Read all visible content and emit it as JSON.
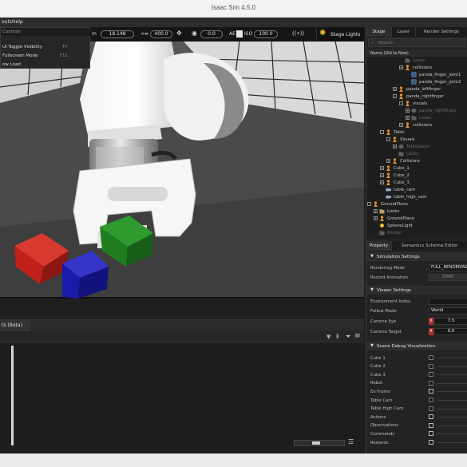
{
  "window": {
    "title": "Isaac Sim 4.5.0"
  },
  "menubar": {
    "items": [
      "outs",
      "Help"
    ]
  },
  "dropdown": {
    "header": "Controls",
    "items": [
      {
        "label": "UI Toggle Visibility",
        "shortcut": "F7"
      },
      {
        "label": "Fullscreen Mode",
        "shortcut": "F11"
      },
      {
        "label": "ow Load",
        "shortcut": ""
      }
    ]
  },
  "viewport_toolbar": {
    "prefix": "m",
    "focal_value": "18.148",
    "near_value": "400.0",
    "exposure_value": "0.0",
    "ae_label": "AE",
    "iso_label": "ISO",
    "iso_value": "100.0",
    "stage_lights_label": "Stage Lights",
    "overlay_tag": "RTX"
  },
  "console": {
    "tab_label": "ts (Beta)"
  },
  "stage": {
    "tabs": [
      "Stage",
      "Layer",
      "Render Settings"
    ],
    "search_placeholder": "Search",
    "column_header": "Name (Old to New)",
    "tree": [
      {
        "label": "Looks",
        "depth": 5,
        "icon": "folder",
        "dim": true,
        "expander": ""
      },
      {
        "label": "collisions",
        "depth": 5,
        "icon": "xform",
        "dim": false,
        "expander": "+"
      },
      {
        "label": "panda_finger_joint1",
        "depth": 6,
        "icon": "joint",
        "dim": false,
        "expander": ""
      },
      {
        "label": "panda_finger_joint2",
        "depth": 6,
        "icon": "joint",
        "dim": false,
        "expander": ""
      },
      {
        "label": "panda_leftfinger",
        "depth": 4,
        "icon": "xform",
        "dim": false,
        "expander": "+"
      },
      {
        "label": "panda_rightfinger",
        "depth": 4,
        "icon": "xform",
        "dim": false,
        "expander": "-"
      },
      {
        "label": "visuals",
        "depth": 5,
        "icon": "xform",
        "dim": false,
        "expander": "-"
      },
      {
        "label": "panda_rightfinger",
        "depth": 6,
        "icon": "mesh",
        "dim": true,
        "expander": "+"
      },
      {
        "label": "Looks",
        "depth": 6,
        "icon": "folder",
        "dim": true,
        "expander": "+"
      },
      {
        "label": "collisions",
        "depth": 5,
        "icon": "xform",
        "dim": false,
        "expander": "+"
      },
      {
        "label": "Table",
        "depth": 2,
        "icon": "xform",
        "dim": false,
        "expander": "-"
      },
      {
        "label": "Visuals",
        "depth": 3,
        "icon": "xform",
        "dim": false,
        "expander": "-"
      },
      {
        "label": "TableGeom",
        "depth": 4,
        "icon": "mesh",
        "dim": true,
        "expander": "+"
      },
      {
        "label": "Looks",
        "depth": 4,
        "icon": "folder",
        "dim": true,
        "expander": ""
      },
      {
        "label": "Collisions",
        "depth": 3,
        "icon": "xform",
        "dim": false,
        "expander": "+"
      },
      {
        "label": "Cube_1",
        "depth": 2,
        "icon": "xform",
        "dim": false,
        "expander": "+"
      },
      {
        "label": "Cube_2",
        "depth": 2,
        "icon": "xform",
        "dim": false,
        "expander": "+"
      },
      {
        "label": "Cube_3",
        "depth": 2,
        "icon": "xform",
        "dim": false,
        "expander": "+"
      },
      {
        "label": "table_cam",
        "depth": 2,
        "icon": "camera",
        "dim": false,
        "expander": ""
      },
      {
        "label": "table_high_cam",
        "depth": 2,
        "icon": "camera",
        "dim": false,
        "expander": ""
      },
      {
        "label": "GroundPlane",
        "depth": 0,
        "icon": "xform",
        "dim": false,
        "expander": "-"
      },
      {
        "label": "Looks",
        "depth": 1,
        "icon": "folder",
        "dim": false,
        "expander": "+"
      },
      {
        "label": "GroundPlane",
        "depth": 1,
        "icon": "xform",
        "dim": false,
        "expander": "+"
      },
      {
        "label": "SphereLight",
        "depth": 1,
        "icon": "light",
        "dim": false,
        "expander": ""
      },
      {
        "label": "Render",
        "depth": 1,
        "icon": "folder",
        "dim": true,
        "expander": ""
      }
    ]
  },
  "property": {
    "tabs": [
      "Property",
      "Semantics Schema Editor"
    ],
    "simulation": {
      "title": "Simulation Settings",
      "rendering_mode_label": "Rendering Mode",
      "rendering_mode_value": "FULL_RENDERING",
      "record_label": "Record Animation",
      "record_button": "START"
    },
    "viewer": {
      "title": "Viewer Settings",
      "env_index_label": "Environment Index",
      "follow_mode_label": "Follow Mode",
      "follow_mode_value": "World",
      "camera_eye_label": "Camera Eye",
      "camera_eye_x": "7.5",
      "camera_target_label": "Camera Target",
      "camera_target_x": "0.0",
      "axis_badge": "X"
    },
    "debug": {
      "title": "Scene Debug Visualization",
      "items": [
        {
          "label": "Cube 1",
          "style": "dim"
        },
        {
          "label": "Cube 2",
          "style": "dim"
        },
        {
          "label": "Cube 3",
          "style": "dim"
        },
        {
          "label": "Robot",
          "style": "dim"
        },
        {
          "label": "Ee Frame",
          "style": "bright"
        },
        {
          "label": "Table Cam",
          "style": "dim"
        },
        {
          "label": "Table High Cam",
          "style": "dim"
        },
        {
          "label": "Actions",
          "style": "bright"
        },
        {
          "label": "Observations",
          "style": "bright"
        },
        {
          "label": "Commands",
          "style": "bright"
        },
        {
          "label": "Rewards",
          "style": "bright"
        }
      ]
    }
  },
  "colors": {
    "cube_red": "#c0201a",
    "cube_blue": "#1a1aa8",
    "cube_green": "#1f7d1f",
    "accent_orange": "#e8952c",
    "stage_light_yellow": "#f2c531"
  }
}
